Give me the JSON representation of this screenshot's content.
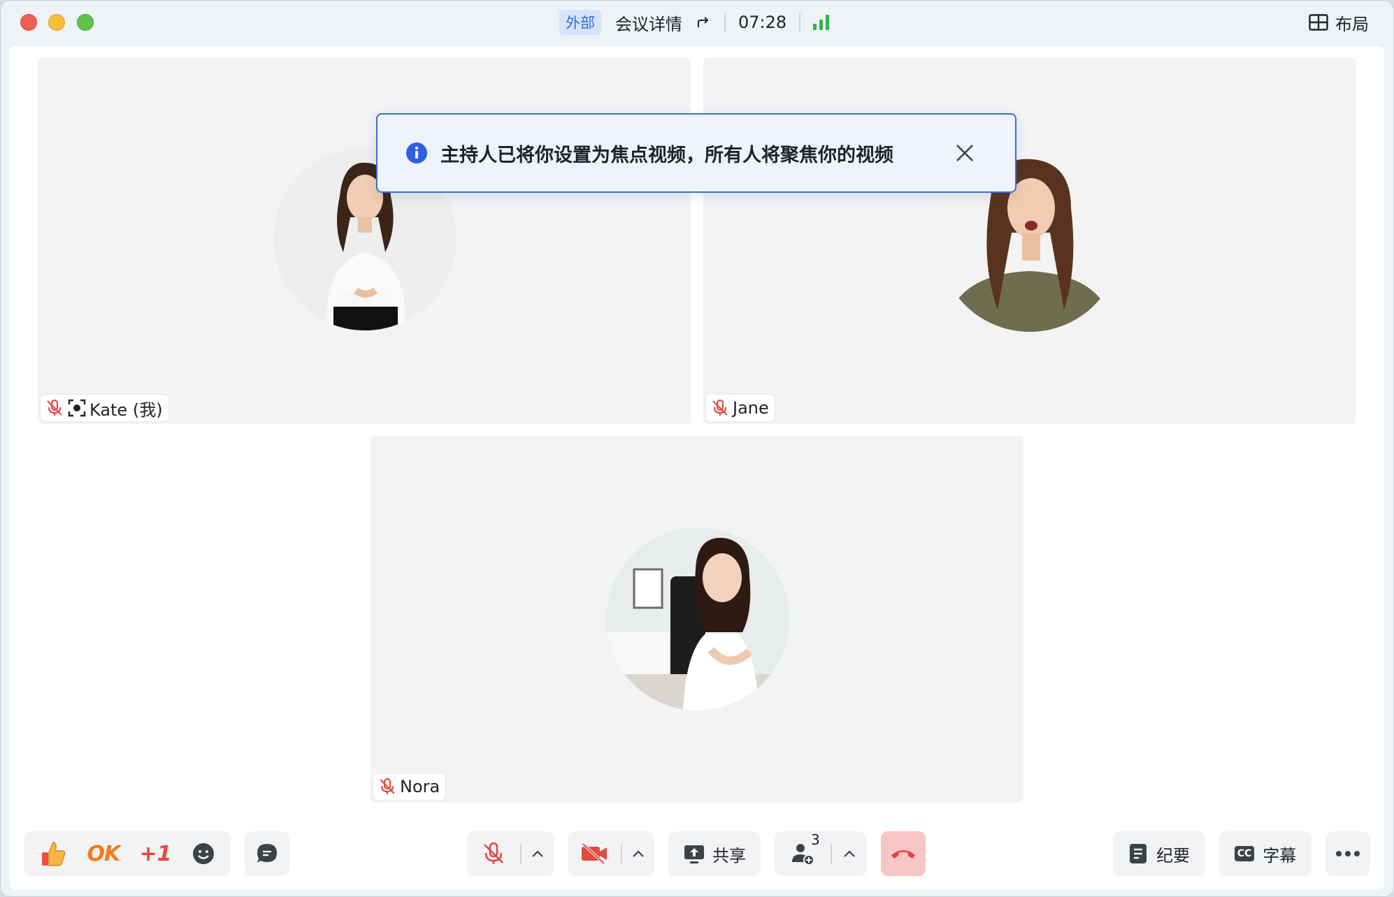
{
  "titlebar": {
    "external_badge": "外部",
    "meeting_details": "会议详情",
    "timer": "07:28",
    "layout_label": "布局"
  },
  "notice": {
    "text": "主持人已将你设置为焦点视频，所有人将聚焦你的视频"
  },
  "participants": [
    {
      "name": "Kate (我)",
      "muted": true,
      "focused": true
    },
    {
      "name": "Jane",
      "muted": true,
      "focused": false
    },
    {
      "name": "Nora",
      "muted": true,
      "focused": false
    }
  ],
  "toolbar": {
    "reactions": {
      "ok": "OK",
      "plus_one": "+1"
    },
    "share_label": "共享",
    "participant_count": "3",
    "notes_label": "纪要",
    "captions_label": "字幕",
    "captions_icon_text": "CC"
  },
  "colors": {
    "accent": "#3a6fdc",
    "muted_red": "#e04b43",
    "signal_green": "#34b34a",
    "hangup_red": "#e5433b"
  }
}
